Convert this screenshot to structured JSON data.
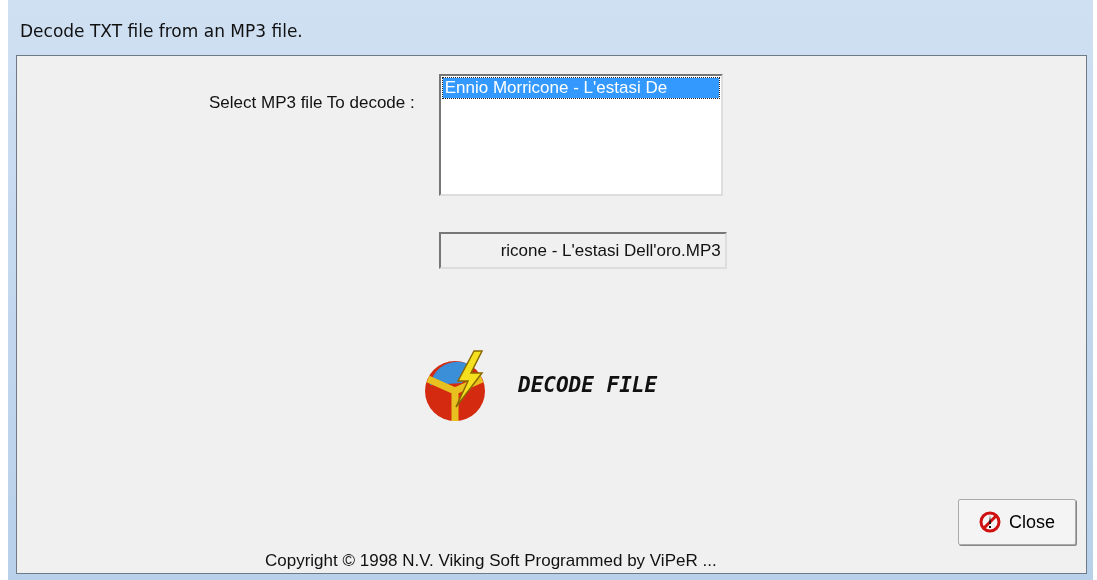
{
  "window": {
    "title": "Decode TXT file from an MP3 file."
  },
  "file_label": "Select MP3 file To decode :",
  "file_list": {
    "items": [
      {
        "label": "Ennio Morricone - L'estasi De",
        "selected": true
      }
    ]
  },
  "file_name_field": {
    "value": "ricone - L'estasi Dell'oro.MP3"
  },
  "decode_button": {
    "label": "DECODE FILE"
  },
  "close_button": {
    "label": "Close"
  },
  "footer": "Copyright © 1998 N.V. Viking Soft   Programmed by ViPeR ..."
}
